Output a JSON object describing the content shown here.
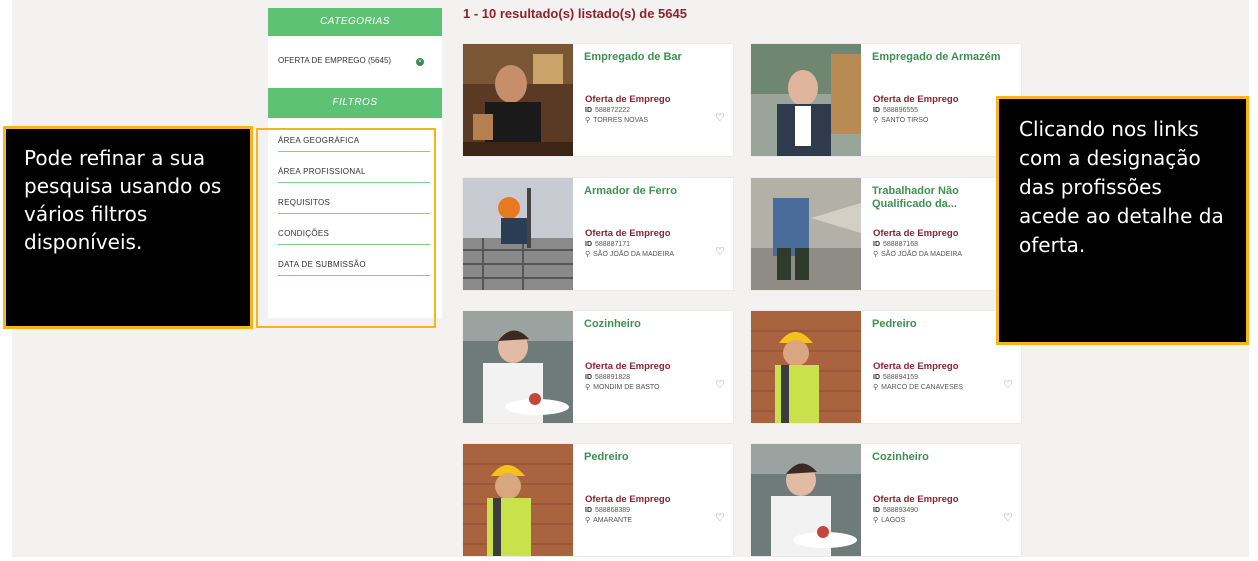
{
  "sidebar": {
    "categories_heading": "CATEGORIAS",
    "category_item": "OFERTA DE EMPREGO (5645)",
    "filters_heading": "FILTROS",
    "filters": [
      "ÁREA GEOGRÁFICA",
      "ÁREA PROFISSIONAL",
      "REQUISITOS",
      "CONDIÇÕES",
      "DATA DE SUBMISSÃO"
    ]
  },
  "results": {
    "title": "1 - 10 resultado(s) listado(s) de 5645",
    "cards": [
      {
        "title": "Empregado de Bar",
        "type": "Oferta de Emprego",
        "id_label": "ID",
        "id": "588872222",
        "location": "TORRES NOVAS"
      },
      {
        "title": "Empregado de Armazém",
        "type": "Oferta de Emprego",
        "id_label": "ID",
        "id": "588896555",
        "location": "SANTO TIRSO"
      },
      {
        "title": "Armador de Ferro",
        "type": "Oferta de Emprego",
        "id_label": "ID",
        "id": "588887171",
        "location": "SÃO JOÃO DA MADEIRA"
      },
      {
        "title": "Trabalhador Não Qualificado da...",
        "type": "Oferta de Emprego",
        "id_label": "ID",
        "id": "588887168",
        "location": "SÃO JOÃO DA MADEIRA"
      },
      {
        "title": "Cozinheiro",
        "type": "Oferta de Emprego",
        "id_label": "ID",
        "id": "588891828",
        "location": "MONDIM DE BASTO"
      },
      {
        "title": "Pedreiro",
        "type": "Oferta de Emprego",
        "id_label": "ID",
        "id": "588894159",
        "location": "MARCO DE CANAVESES"
      },
      {
        "title": "Pedreiro",
        "type": "Oferta de Emprego",
        "id_label": "ID",
        "id": "588868389",
        "location": "AMARANTE"
      },
      {
        "title": "Cozinheiro",
        "type": "Oferta de Emprego",
        "id_label": "ID",
        "id": "588893490",
        "location": "LAGOS"
      }
    ]
  },
  "annotations": {
    "left": "Pode refinar a sua pesquisa usando os vários filtros disponíveis.",
    "right": "Clicando nos links com a designação das profissões acede ao detalhe da oferta."
  },
  "icons": {
    "location": "location-pin-icon",
    "favorite": "heart-icon",
    "clear": "close-icon"
  },
  "colors": {
    "accent_green": "#5ec274",
    "title_green": "#3e9152",
    "maroon": "#8b2332",
    "annotation_border": "#f7b51b"
  }
}
